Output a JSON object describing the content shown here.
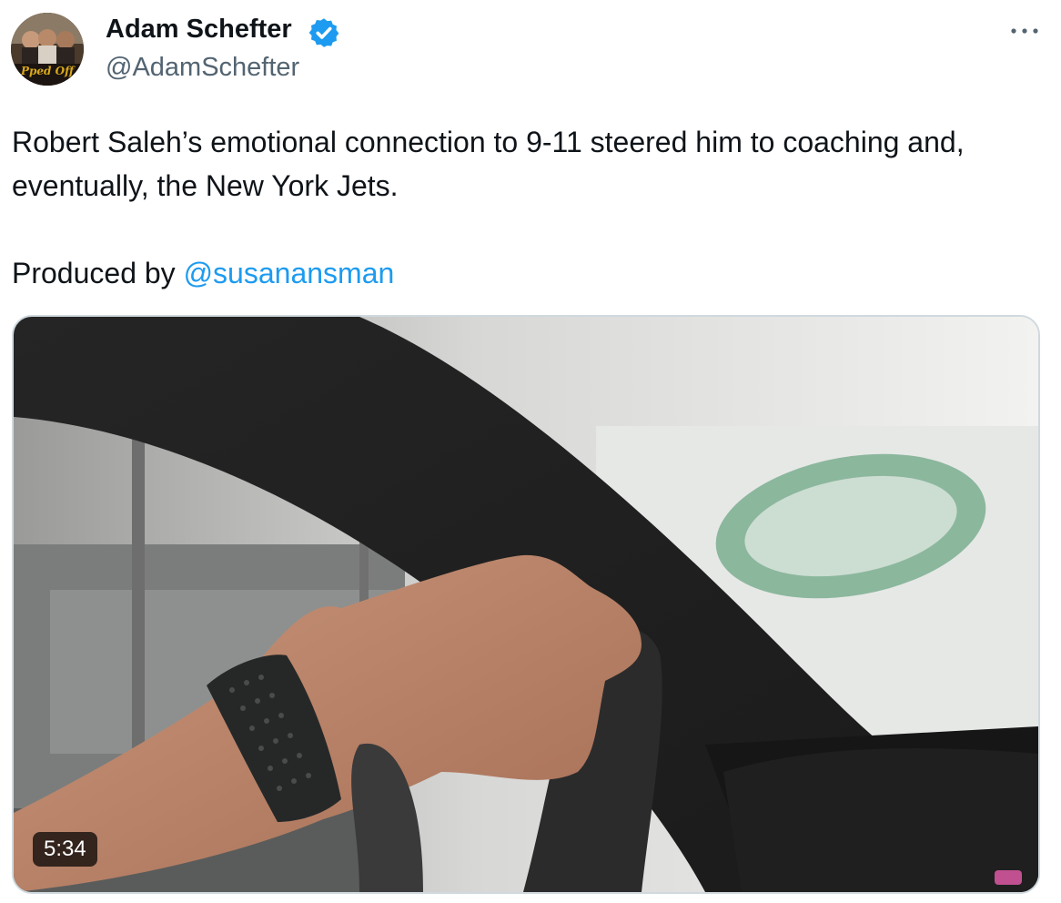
{
  "author": {
    "display_name": "Adam Schefter",
    "handle": "@AdamSchefter",
    "avatar_icon": "avatar-photo",
    "avatar_text": "Pped Off",
    "verified": true,
    "verified_color": "#1d9bf0"
  },
  "menu": {
    "more_icon": "more-dots-icon"
  },
  "tweet": {
    "text_line1": "Robert Saleh’s emotional connection to 9-11 steered him to coaching and, eventually, the New York Jets.",
    "produced_by_prefix": "Produced by ",
    "mention": "@susanansman",
    "mention_color": "#1d9bf0"
  },
  "media": {
    "type": "video",
    "duration": "5:34"
  }
}
